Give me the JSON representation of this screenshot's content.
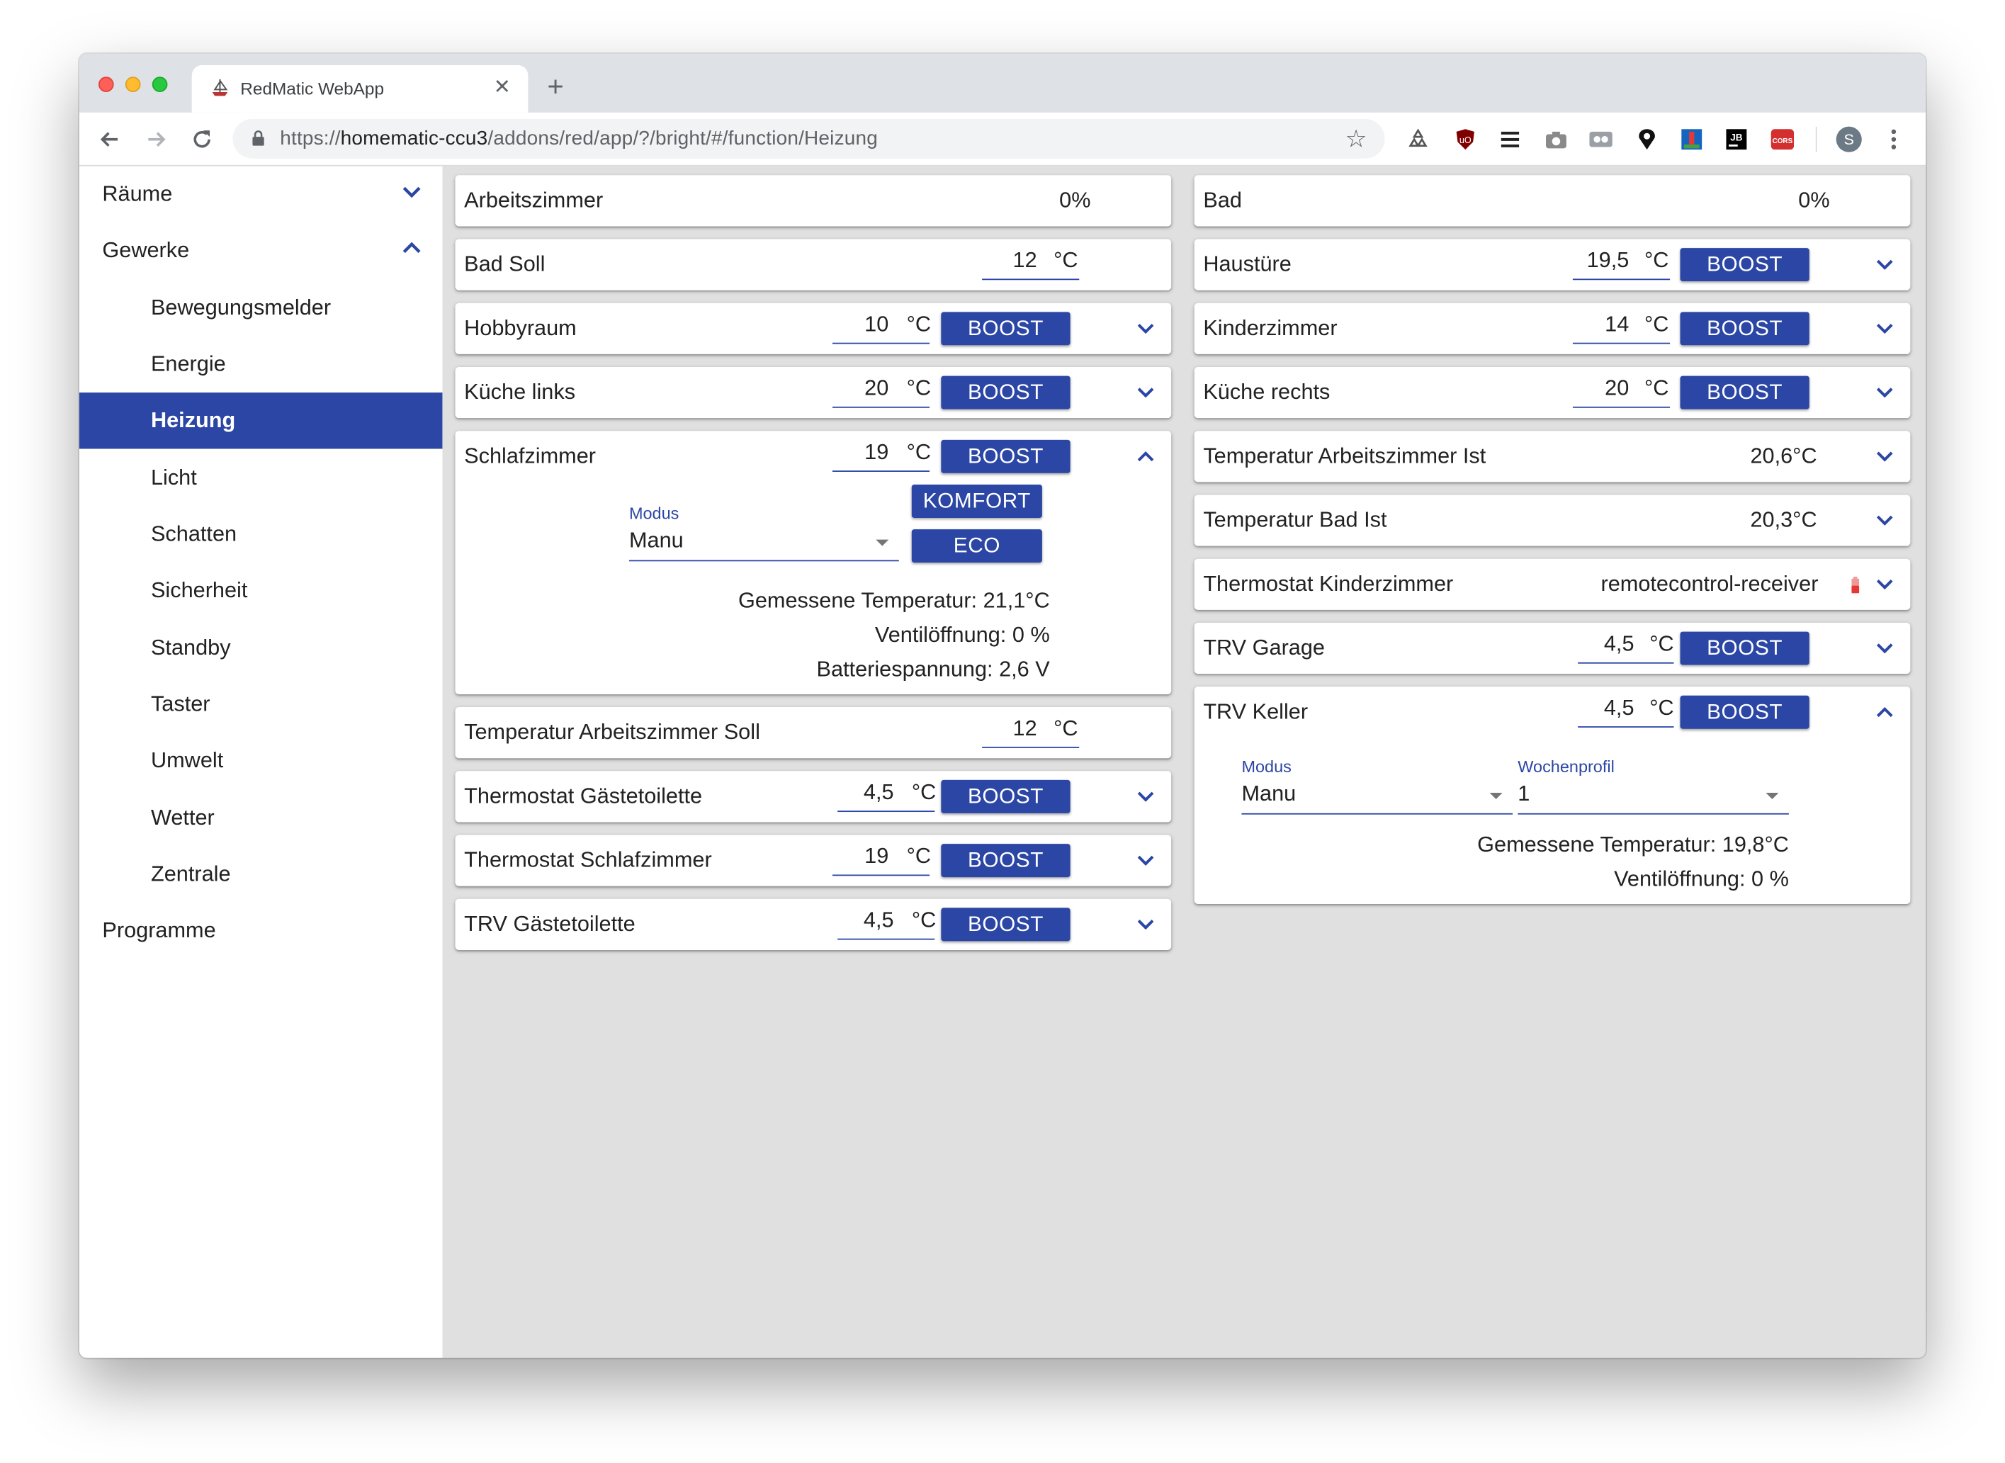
{
  "browser": {
    "tab_title": "RedMatic WebApp",
    "url_scheme": "https://",
    "url_host": "homematic-ccu3",
    "url_path": "/addons/red/app/?/bright/#/function/Heizung",
    "profile_initial": "S"
  },
  "sidebar": {
    "items": [
      {
        "label": "Räume",
        "expanded": false
      },
      {
        "label": "Gewerke",
        "expanded": true
      },
      {
        "label": "Bewegungsmelder"
      },
      {
        "label": "Energie"
      },
      {
        "label": "Heizung",
        "active": true
      },
      {
        "label": "Licht"
      },
      {
        "label": "Schatten"
      },
      {
        "label": "Sicherheit"
      },
      {
        "label": "Standby"
      },
      {
        "label": "Taster"
      },
      {
        "label": "Umwelt"
      },
      {
        "label": "Wetter"
      },
      {
        "label": "Zentrale"
      },
      {
        "label": "Programme"
      }
    ]
  },
  "labels": {
    "boost": "BOOST",
    "komfort": "KOMFORT",
    "eco": "ECO",
    "unit": "°C",
    "modus": "Modus",
    "wochenprofil": "Wochenprofil"
  },
  "left": [
    {
      "name": "Arbeitszimmer",
      "value": "0%"
    },
    {
      "name": "Bad Soll",
      "setpoint": "12"
    },
    {
      "name": "Hobbyraum",
      "setpoint": "10"
    },
    {
      "name": "Küche links",
      "setpoint": "20"
    },
    {
      "name": "Schlafzimmer",
      "setpoint": "19",
      "expanded": true,
      "modus": "Manu",
      "info": [
        "Gemessene Temperatur: 21,1°C",
        "Ventilöffnung: 0 %",
        "Batteriespannung: 2,6 V"
      ]
    },
    {
      "name": "Temperatur Arbeitszimmer Soll",
      "setpoint": "12"
    },
    {
      "name": "Thermostat Gästetoilette",
      "setpoint": "4,5"
    },
    {
      "name": "Thermostat Schlafzimmer",
      "setpoint": "19"
    },
    {
      "name": "TRV Gästetoilette",
      "setpoint": "4,5"
    }
  ],
  "right": [
    {
      "name": "Bad",
      "value": "0%"
    },
    {
      "name": "Haustüre",
      "setpoint": "19,5"
    },
    {
      "name": "Kinderzimmer",
      "setpoint": "14"
    },
    {
      "name": "Küche rechts",
      "setpoint": "20"
    },
    {
      "name": "Temperatur Arbeitszimmer Ist",
      "value": "20,6°C"
    },
    {
      "name": "Temperatur Bad Ist",
      "value": "20,3°C"
    },
    {
      "name": "Thermostat Kinderzimmer",
      "value": "remotecontrol-receiver"
    },
    {
      "name": "TRV Garage",
      "setpoint": "4,5"
    },
    {
      "name": "TRV Keller",
      "setpoint": "4,5",
      "expanded": true,
      "modus": "Manu",
      "wochenprofil": "1",
      "info": [
        "Gemessene Temperatur: 19,8°C",
        "Ventilöffnung: 0 %"
      ]
    }
  ],
  "colors": {
    "accent": "#2b46a5",
    "battery_low": "#e53935"
  }
}
